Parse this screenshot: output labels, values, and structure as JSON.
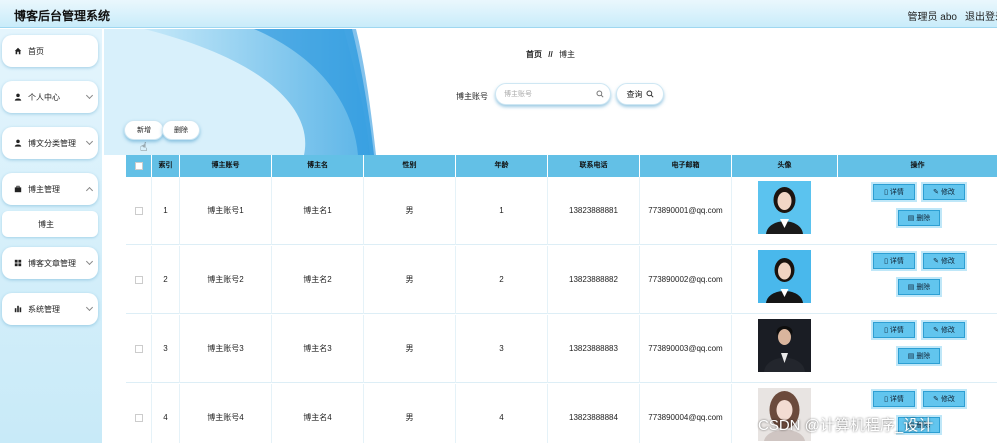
{
  "header": {
    "title": "博客后台管理系统",
    "admin": "管理员 abo",
    "logout": "退出登录"
  },
  "sidebar": {
    "items": [
      {
        "label": "首页",
        "icon": "home-icon"
      },
      {
        "label": "个人中心",
        "icon": "user-icon"
      },
      {
        "label": "博文分类管理",
        "icon": "user-icon"
      },
      {
        "label": "博主管理",
        "icon": "briefcase-icon",
        "sub": "博主"
      },
      {
        "label": "博客文章管理",
        "icon": "grid-icon"
      },
      {
        "label": "系统管理",
        "icon": "chart-icon"
      }
    ]
  },
  "breadcrumb": {
    "home": "首页",
    "sep": "//",
    "current": "博主"
  },
  "search": {
    "label": "博主账号",
    "placeholder": "博主账号",
    "button": "查询"
  },
  "actions": {
    "add": "新增",
    "delete": "删除"
  },
  "table": {
    "headers": [
      "索引",
      "博主账号",
      "博主名",
      "性别",
      "年龄",
      "联系电话",
      "电子邮箱",
      "头像",
      "操作"
    ],
    "rows": [
      {
        "index": "1",
        "account": "博主账号1",
        "name": "博主名1",
        "gender": "男",
        "age": "1",
        "phone": "13823888881",
        "email": "773890001@qq.com"
      },
      {
        "index": "2",
        "account": "博主账号2",
        "name": "博主名2",
        "gender": "男",
        "age": "2",
        "phone": "13823888882",
        "email": "773890002@qq.com"
      },
      {
        "index": "3",
        "account": "博主账号3",
        "name": "博主名3",
        "gender": "男",
        "age": "3",
        "phone": "13823888883",
        "email": "773890003@qq.com"
      },
      {
        "index": "4",
        "account": "博主账号4",
        "name": "博主名4",
        "gender": "男",
        "age": "4",
        "phone": "13823888884",
        "email": "773890004@qq.com"
      }
    ],
    "ops": {
      "detail": "详情",
      "edit": "修改",
      "delete": "删除"
    }
  },
  "watermark": "CSDN @计算机程序_设计",
  "colors": {
    "accent": "#63c0e6",
    "op_button": "#62c5ee"
  }
}
